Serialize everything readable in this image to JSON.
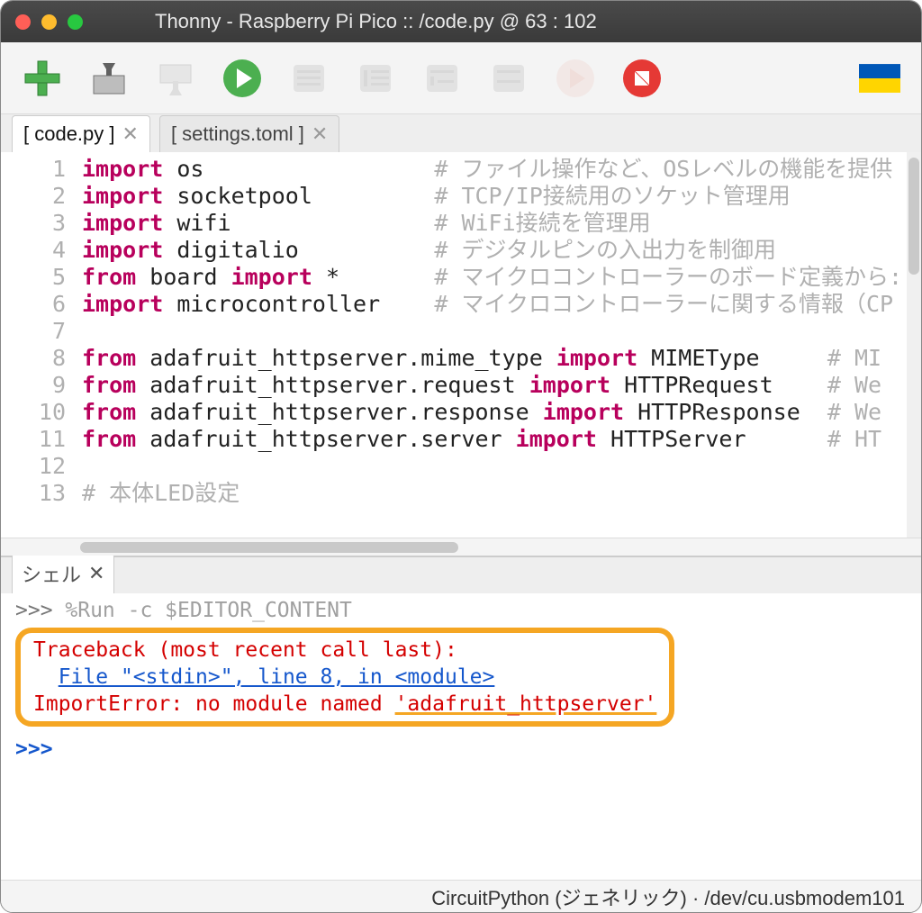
{
  "window": {
    "title": "Thonny  -  Raspberry Pi Pico :: /code.py  @  63 : 102"
  },
  "toolbar": {
    "new": "new-file",
    "open": "open-file",
    "save": "save-file",
    "run": "run",
    "debug": "debug",
    "step_over": "step-over",
    "step_into": "step-into",
    "step_out": "step-out",
    "resume": "resume",
    "stop": "stop",
    "support": "support"
  },
  "tabs": [
    {
      "label": "[ code.py ]",
      "active": true
    },
    {
      "label": "[ settings.toml ]",
      "active": false
    }
  ],
  "code": {
    "lines": [
      {
        "n": 1,
        "tokens": [
          [
            "kw",
            "import"
          ],
          [
            "txt",
            " os                 "
          ],
          [
            "cmt",
            "# ファイル操作など、OSレベルの機能を提供"
          ]
        ]
      },
      {
        "n": 2,
        "tokens": [
          [
            "kw",
            "import"
          ],
          [
            "txt",
            " socketpool         "
          ],
          [
            "cmt",
            "# TCP/IP接続用のソケット管理用"
          ]
        ]
      },
      {
        "n": 3,
        "tokens": [
          [
            "kw",
            "import"
          ],
          [
            "txt",
            " wifi               "
          ],
          [
            "cmt",
            "# WiFi接続を管理用"
          ]
        ]
      },
      {
        "n": 4,
        "tokens": [
          [
            "kw",
            "import"
          ],
          [
            "txt",
            " digitalio          "
          ],
          [
            "cmt",
            "# デジタルピンの入出力を制御用"
          ]
        ]
      },
      {
        "n": 5,
        "tokens": [
          [
            "kw",
            "from"
          ],
          [
            "txt",
            " board "
          ],
          [
            "kw",
            "import"
          ],
          [
            "txt",
            " *       "
          ],
          [
            "cmt",
            "# マイクロコントローラーのボード定義から:"
          ]
        ]
      },
      {
        "n": 6,
        "tokens": [
          [
            "kw",
            "import"
          ],
          [
            "txt",
            " microcontroller    "
          ],
          [
            "cmt",
            "# マイクロコントローラーに関する情報（CP"
          ]
        ]
      },
      {
        "n": 7,
        "tokens": [
          [
            "txt",
            ""
          ]
        ]
      },
      {
        "n": 8,
        "tokens": [
          [
            "kw",
            "from"
          ],
          [
            "txt",
            " adafruit_httpserver.mime_type "
          ],
          [
            "kw",
            "import"
          ],
          [
            "txt",
            " MIMEType     "
          ],
          [
            "cmt",
            "# MI"
          ]
        ]
      },
      {
        "n": 9,
        "tokens": [
          [
            "kw",
            "from"
          ],
          [
            "txt",
            " adafruit_httpserver.request "
          ],
          [
            "kw",
            "import"
          ],
          [
            "txt",
            " HTTPRequest    "
          ],
          [
            "cmt",
            "# We"
          ]
        ]
      },
      {
        "n": 10,
        "tokens": [
          [
            "kw",
            "from"
          ],
          [
            "txt",
            " adafruit_httpserver.response "
          ],
          [
            "kw",
            "import"
          ],
          [
            "txt",
            " HTTPResponse  "
          ],
          [
            "cmt",
            "# We"
          ]
        ]
      },
      {
        "n": 11,
        "tokens": [
          [
            "kw",
            "from"
          ],
          [
            "txt",
            " adafruit_httpserver.server "
          ],
          [
            "kw",
            "import"
          ],
          [
            "txt",
            " HTTPServer      "
          ],
          [
            "cmt",
            "# HT"
          ]
        ]
      },
      {
        "n": 12,
        "tokens": [
          [
            "txt",
            ""
          ]
        ]
      },
      {
        "n": 13,
        "tokens": [
          [
            "cmt",
            "# 本体LED設定"
          ]
        ]
      }
    ]
  },
  "shell": {
    "tab_label": "シェル",
    "run_line": {
      "prompt": ">>> ",
      "cmd": "%Run -c $EDITOR_CONTENT"
    },
    "traceback_header": "Traceback (most recent call last):",
    "traceback_file": "File \"<stdin>\", line 8, in <module>",
    "error_line_prefix": "ImportError: no module named ",
    "error_module": "'adafruit_httpserver'",
    "empty_prompt": ">>> "
  },
  "statusbar": {
    "text": "CircuitPython (ジェネリック)  ·  /dev/cu.usbmodem101"
  }
}
